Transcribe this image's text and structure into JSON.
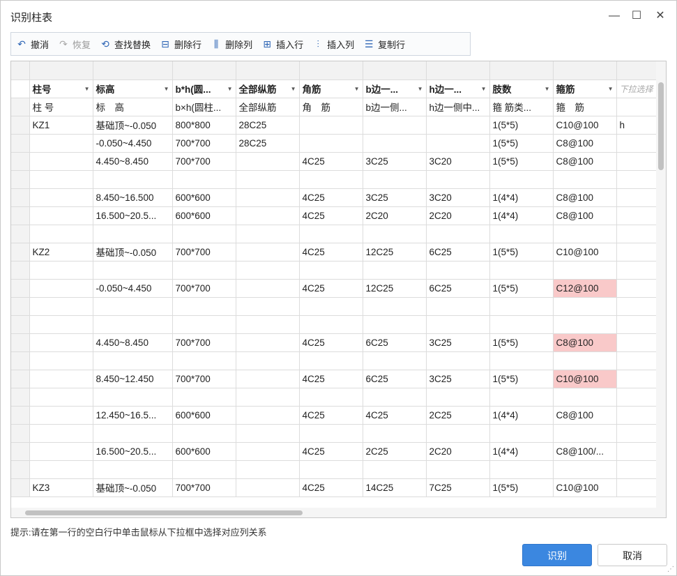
{
  "window": {
    "title": "识别柱表",
    "minimize": "—",
    "maximize": "☐",
    "close": "✕"
  },
  "toolbar": [
    {
      "label": "撤消",
      "icon": "undo-icon",
      "glyph": "↶",
      "disabled": false
    },
    {
      "label": "恢复",
      "icon": "redo-icon",
      "glyph": "↷",
      "disabled": true
    },
    {
      "label": "查找替换",
      "icon": "find-replace-icon",
      "glyph": "⟲",
      "disabled": false
    },
    {
      "label": "删除行",
      "icon": "delete-row-icon",
      "glyph": "⊟",
      "disabled": false
    },
    {
      "label": "删除列",
      "icon": "delete-column-icon",
      "glyph": "⫼",
      "disabled": false
    },
    {
      "label": "插入行",
      "icon": "insert-row-icon",
      "glyph": "⊞",
      "disabled": false
    },
    {
      "label": "插入列",
      "icon": "insert-column-icon",
      "glyph": "⫶",
      "disabled": false
    },
    {
      "label": "复制行",
      "icon": "copy-row-icon",
      "glyph": "☰",
      "disabled": false
    }
  ],
  "grid": {
    "selectors": [
      "柱号",
      "标高",
      "b*h(圆...",
      "全部纵筋",
      "角筋",
      "b边一...",
      "h边一...",
      "肢数",
      "箍筋",
      "下拉选择"
    ],
    "headers": [
      "柱 号",
      "标　高",
      "b×h(圆柱...",
      "全部纵筋",
      "角　筋",
      "b边一侧...",
      "h边一侧中...",
      "箍 筋类...",
      "箍　筋",
      ""
    ],
    "rows": [
      [
        "KZ1",
        "基础顶~-0.050",
        "800*800",
        "28C25",
        "",
        "",
        "",
        "1(5*5)",
        "C10@100",
        "h"
      ],
      [
        "",
        "-0.050~4.450",
        "700*700",
        "28C25",
        "",
        "",
        "",
        "1(5*5)",
        "C8@100",
        ""
      ],
      [
        "",
        "4.450~8.450",
        "700*700",
        "",
        "4C25",
        "3C25",
        "3C20",
        "1(5*5)",
        "C8@100",
        ""
      ],
      [
        "",
        "",
        "",
        "",
        "",
        "",
        "",
        "",
        "",
        ""
      ],
      [
        "",
        "8.450~16.500",
        "600*600",
        "",
        "4C25",
        "3C25",
        "3C20",
        "1(4*4)",
        "C8@100",
        ""
      ],
      [
        "",
        "16.500~20.5...",
        "600*600",
        "",
        "4C25",
        "2C20",
        "2C20",
        "1(4*4)",
        "C8@100",
        ""
      ],
      [
        "",
        "",
        "",
        "",
        "",
        "",
        "",
        "",
        "",
        ""
      ],
      [
        "KZ2",
        "基础顶~-0.050",
        "700*700",
        "",
        "4C25",
        "12C25",
        "6C25",
        "1(5*5)",
        "C10@100",
        ""
      ],
      [
        "",
        "",
        "",
        "",
        "",
        "",
        "",
        "",
        "",
        ""
      ],
      [
        "",
        "-0.050~4.450",
        "700*700",
        "",
        "4C25",
        "12C25",
        "6C25",
        "1(5*5)",
        "C12@100",
        ""
      ],
      [
        "",
        "",
        "",
        "",
        "",
        "",
        "",
        "",
        "",
        ""
      ],
      [
        "",
        "",
        "",
        "",
        "",
        "",
        "",
        "",
        "",
        ""
      ],
      [
        "",
        "4.450~8.450",
        "700*700",
        "",
        "4C25",
        "6C25",
        "3C25",
        "1(5*5)",
        "C8@100",
        ""
      ],
      [
        "",
        "",
        "",
        "",
        "",
        "",
        "",
        "",
        "",
        ""
      ],
      [
        "",
        "8.450~12.450",
        "700*700",
        "",
        "4C25",
        "6C25",
        "3C25",
        "1(5*5)",
        "C10@100",
        ""
      ],
      [
        "",
        "",
        "",
        "",
        "",
        "",
        "",
        "",
        "",
        ""
      ],
      [
        "",
        "12.450~16.5...",
        "600*600",
        "",
        "4C25",
        "4C25",
        "2C25",
        "1(4*4)",
        "C8@100",
        ""
      ],
      [
        "",
        "",
        "",
        "",
        "",
        "",
        "",
        "",
        "",
        ""
      ],
      [
        "",
        "16.500~20.5...",
        "600*600",
        "",
        "4C25",
        "2C25",
        "2C20",
        "1(4*4)",
        "C8@100/...",
        ""
      ],
      [
        "",
        "",
        "",
        "",
        "",
        "",
        "",
        "",
        "",
        ""
      ],
      [
        "KZ3",
        "基础顶~-0.050",
        "700*700",
        "",
        "4C25",
        "14C25",
        "7C25",
        "1(5*5)",
        "C10@100",
        ""
      ]
    ],
    "highlight_color": "#f9c9c9",
    "highlighted_cells": [
      [
        9,
        8
      ],
      [
        12,
        8
      ],
      [
        14,
        8
      ]
    ]
  },
  "hint": "提示:请在第一行的空白行中单击鼠标从下拉框中选择对应列关系",
  "buttons": {
    "ok": "识别",
    "cancel": "取消"
  },
  "colors": {
    "primary": "#3b87e0"
  }
}
